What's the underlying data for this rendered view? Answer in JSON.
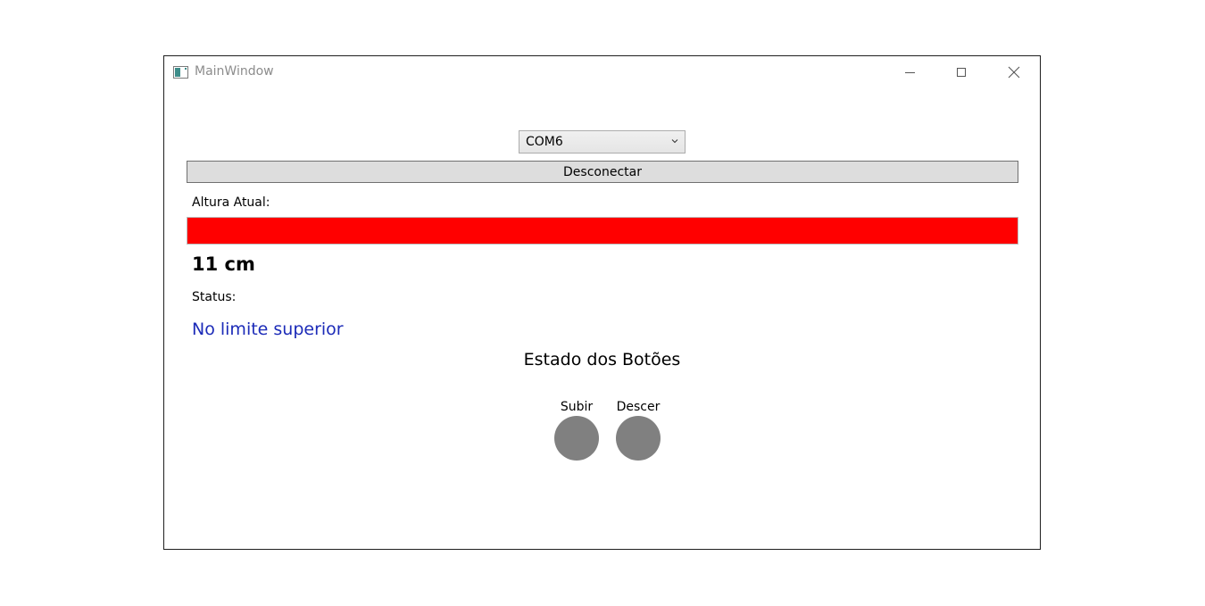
{
  "window": {
    "title": "MainWindow",
    "controls": {
      "minimize_icon": "minimize-icon",
      "maximize_icon": "maximize-icon",
      "close_icon": "close-icon"
    }
  },
  "connection": {
    "port_selected": "COM6",
    "connect_button_label": "Desconectar"
  },
  "height": {
    "label": "Altura Atual:",
    "progress_percent": 100,
    "bar_color": "#ff0000",
    "value_text": "11 cm"
  },
  "status": {
    "label": "Status:",
    "value": "No limite superior",
    "value_color": "#1c2bb8"
  },
  "buttons_state": {
    "title": "Estado dos Botões",
    "items": [
      {
        "label": "Subir",
        "led_color": "#808080"
      },
      {
        "label": "Descer",
        "led_color": "#808080"
      }
    ]
  }
}
